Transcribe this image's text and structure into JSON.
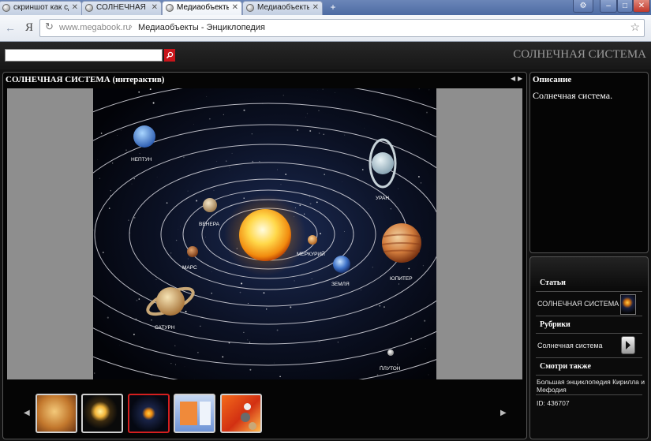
{
  "browser": {
    "tabs": [
      {
        "label": "скриншот как сделат",
        "active": false
      },
      {
        "label": "СОЛНЕЧНАЯ СИСТЕМ",
        "active": false
      },
      {
        "label": "Медиаобъекты - Энци",
        "active": true
      },
      {
        "label": "Медиаобъекты - Энци",
        "active": false
      }
    ],
    "new_tab_label": "+",
    "window_controls": {
      "minimize": "–",
      "maximize": "□",
      "close": "✕"
    },
    "gear_label": "⚙",
    "back_label": "←",
    "brand": "Я",
    "reload_label": "↻",
    "star_label": "☆",
    "url": {
      "domain": "www.megabook.ru",
      "separator": "›",
      "title": "Медиаобъекты - Энциклопедия"
    }
  },
  "site": {
    "search_placeholder": "",
    "search_icon": "magnifier-icon",
    "title": "СОЛНЕЧНАЯ СИСТЕМА"
  },
  "viewer": {
    "title": "СОЛНЕЧНАЯ СИСТЕМА (интерактив)",
    "prev_label": "◀",
    "next_label": "▶",
    "planets": {
      "neptune": "НЕПТУН",
      "uranus": "УРАН",
      "venus": "ВЕНЕРА",
      "mercury": "МЕРКУРИЙ",
      "mars": "МАРС",
      "earth": "ЗЕМЛЯ",
      "jupiter": "ЮПИТЕР",
      "saturn": "САТУРН",
      "pluto": "ПЛУТОН"
    }
  },
  "description": {
    "header": "Описание",
    "text": "Солнечная система."
  },
  "sidebar": {
    "articles_header": "Статьи",
    "article_item": "СОЛНЕЧНАЯ СИСТЕМА",
    "rubrics_header": "Рубрики",
    "rubric_item": "Солнечная система",
    "see_also_header": "Смотри также",
    "see_also_item": "Большая энциклопедия Кирилла и Мефодия",
    "id_text": "ID: 436707"
  },
  "colors": {
    "accent_red": "#c8151b",
    "panel_bg": "#050505",
    "page_bg": "#121212"
  }
}
